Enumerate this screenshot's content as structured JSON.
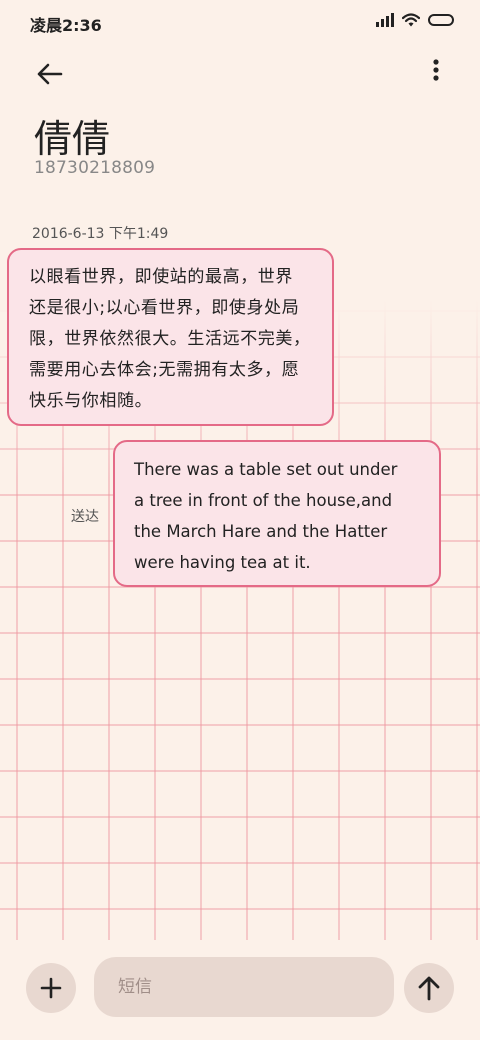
{
  "status_bar": {
    "time": "凌晨2:36"
  },
  "header": {
    "contact_name": "倩倩",
    "contact_number": "18730218809"
  },
  "conversation": {
    "date_stamp": "2016-6-13 下午1:49",
    "messages": [
      {
        "direction": "incoming",
        "lines": [
          "以眼看世界，即使站的最高，世界",
          "还是很小;以心看世界，即使身处局",
          "限，世界依然很大。生活远不完美，",
          "需要用心去体会;无需拥有太多，愿",
          "快乐与你相随。"
        ]
      },
      {
        "direction": "outgoing",
        "status": "送达",
        "lines": [
          "There was a table set out under",
          "a tree in front of the house,and",
          "the March Hare and the Hatter",
          "were having tea at it."
        ]
      }
    ]
  },
  "composer": {
    "placeholder": "短信",
    "value": ""
  },
  "icons": {
    "back": "arrow-left-icon",
    "menu": "more-vertical-icon",
    "add": "plus-icon",
    "send": "arrow-up-icon",
    "signal": "signal-bars-icon",
    "wifi": "wifi-icon",
    "battery": "battery-icon"
  },
  "colors": {
    "background": "#fcf1e9",
    "bubble_fill": "#fbe4e8",
    "bubble_border": "#e46a87",
    "grid": "#ee96a0",
    "button_fill": "#e8d8d0"
  }
}
